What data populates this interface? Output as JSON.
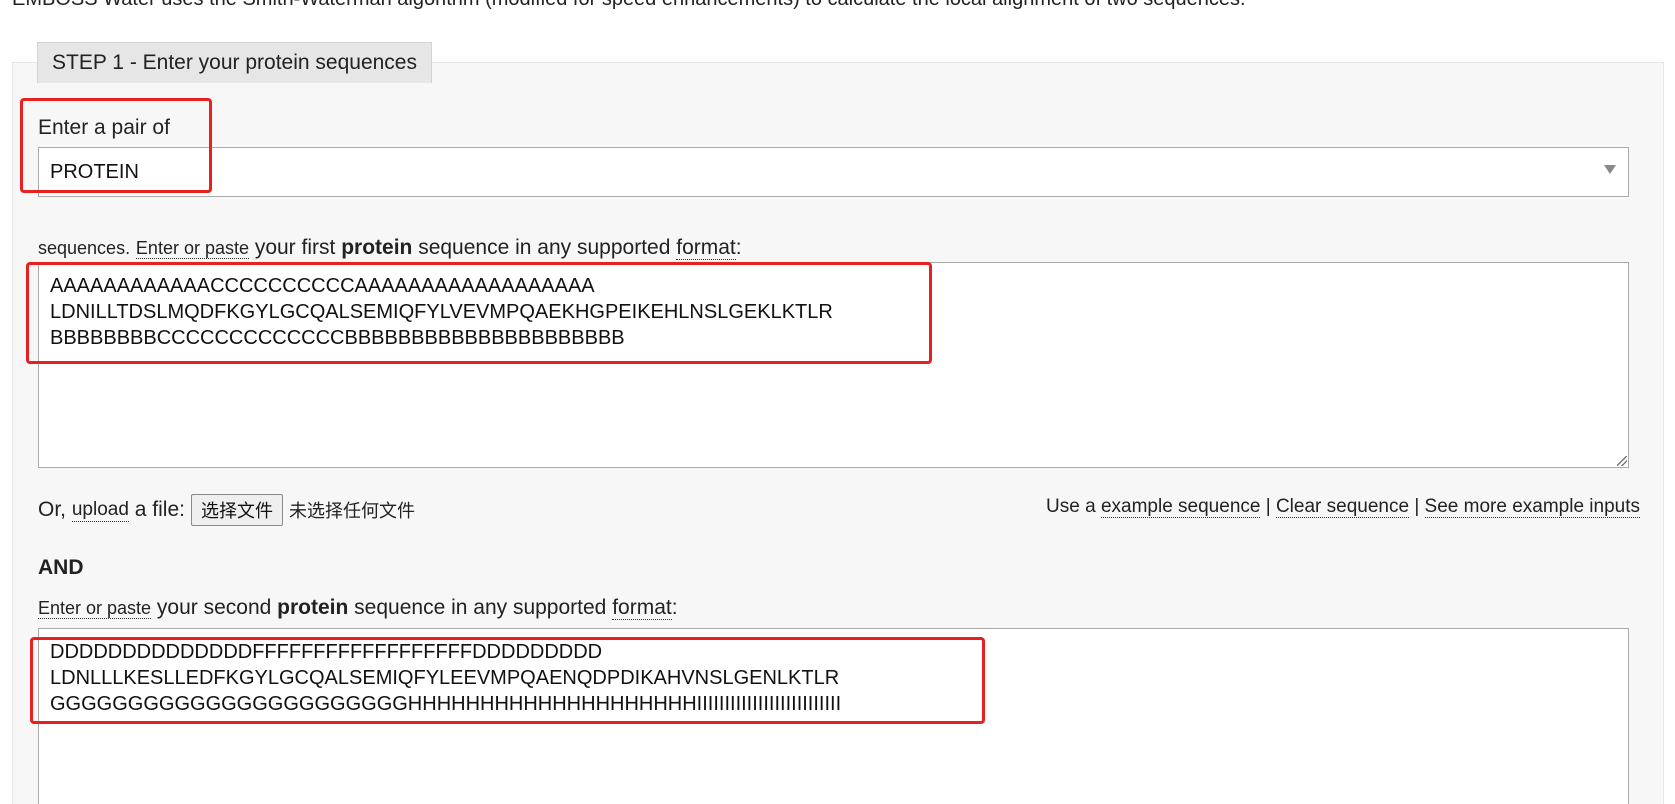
{
  "intro": {
    "text": "EMBOSS Water uses the Smith-Waterman algorithm (modified for speed enhancements) to calculate the local alignment of two sequences."
  },
  "step1": {
    "tab_label": "STEP 1 - Enter your protein sequences",
    "pair_label": "Enter a pair of",
    "select_value": "PROTEIN",
    "seq1_label": {
      "prefix": "sequences.",
      "link": "Enter or paste",
      "middle1": "your first",
      "bold": "protein",
      "middle2": "sequence in any supported",
      "format_link": "format",
      "suffix": ":"
    },
    "seq1_value": "AAAAAAAAAAAACCCCCCCCCCAAAAAAAAAAAAAAAAAA\nLDNILLTDSLMQDFKGYLGCQALSEMIQFYLVEVMPQAEKHGPEIKEHLNSLGEKLKTLR\nBBBBBBBBCCCCCCCCCCCCCBBBBBBBBBBBBBBBBBBBBB",
    "upload": {
      "or": "Or,",
      "link": "upload",
      "a_file": "a file:",
      "button": "选择文件",
      "status": "未选择任何文件"
    },
    "links": {
      "use_prefix": "Use a",
      "example": "example sequence",
      "sep1": "|",
      "clear": "Clear sequence",
      "sep2": "|",
      "more": "See more example inputs"
    },
    "and_label": "AND",
    "seq2_label": {
      "link": "Enter or paste",
      "middle1": "your second",
      "bold": "protein",
      "middle2": "sequence in any supported",
      "format_link": "format",
      "suffix": ":"
    },
    "seq2_value": "DDDDDDDDDDDDDDFFFFFFFFFFFFFFFFFFDDDDDDDDD\nLDNLLLKESLLEDFKGYLGCQALSEMIQFYLEEVMPQAENQDPDIKAHVNSLGENLKTLR\nGGGGGGGGGGGGGGGGGGGGGGGHHHHHHHHHHHHHHHHHHHHIIIIIIIIIIIIIIIIIIIIIIIIII"
  },
  "colors": {
    "highlight": "#e82020",
    "panel_bg": "#f7f7f7",
    "tab_bg": "#e6e6e6"
  }
}
